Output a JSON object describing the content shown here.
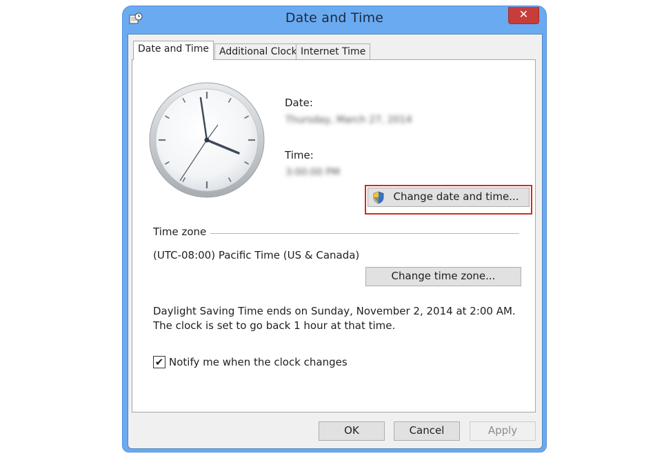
{
  "window": {
    "title": "Date and Time",
    "close_label": "✕"
  },
  "tabs": [
    {
      "label": "Date and Time",
      "active": true
    },
    {
      "label": "Additional Clocks",
      "active": false
    },
    {
      "label": "Internet Time",
      "active": false
    }
  ],
  "datetime": {
    "date_label": "Date:",
    "date_value": "Thursday, March 27, 2014",
    "time_label": "Time:",
    "time_value": "3:00:00 PM",
    "change_button": "Change date and time..."
  },
  "timezone": {
    "group_label": "Time zone",
    "value": "(UTC-08:00) Pacific Time (US & Canada)",
    "change_button": "Change time zone..."
  },
  "dst_note": "Daylight Saving Time ends on Sunday, November 2, 2014 at 2:00 AM. The clock is set to go back 1 hour at that time.",
  "notify": {
    "label": "Notify me when the clock changes",
    "checked": true,
    "check_glyph": "✔"
  },
  "footer": {
    "ok": "OK",
    "cancel": "Cancel",
    "apply": "Apply"
  },
  "colors": {
    "frame": "#6aaaf0",
    "close": "#c73d3a",
    "highlight": "#d9261c"
  }
}
